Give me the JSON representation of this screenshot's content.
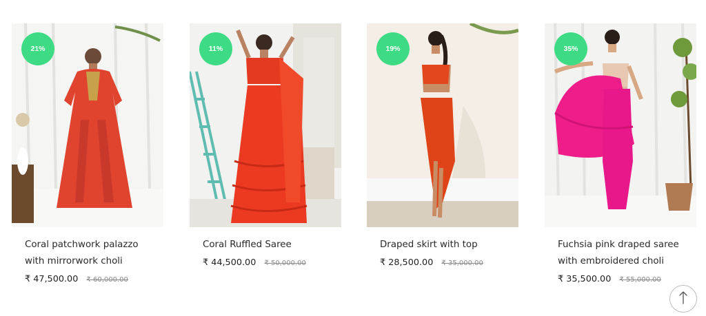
{
  "products": [
    {
      "title": "Coral patchwork palazzo with mirrorwork choli",
      "discount": "21%",
      "price": "₹ 47,500.00",
      "original_price": "₹ 60,000.00"
    },
    {
      "title": "Coral Ruffled Saree",
      "discount": "11%",
      "price": "₹ 44,500.00",
      "original_price": "₹ 50,000.00"
    },
    {
      "title": "Draped skirt with top",
      "discount": "19%",
      "price": "₹ 28,500.00",
      "original_price": "₹ 35,000.00"
    },
    {
      "title": "Fuchsia pink draped saree with embroidered choli",
      "discount": "35%",
      "price": "₹ 35,500.00",
      "original_price": "₹ 55,000.00"
    }
  ],
  "colors": {
    "badge": "#3ddc84",
    "text": "#2a2a2a",
    "strike": "#8a8a8a"
  },
  "icons": {
    "scroll_top": "arrow-up-icon"
  }
}
